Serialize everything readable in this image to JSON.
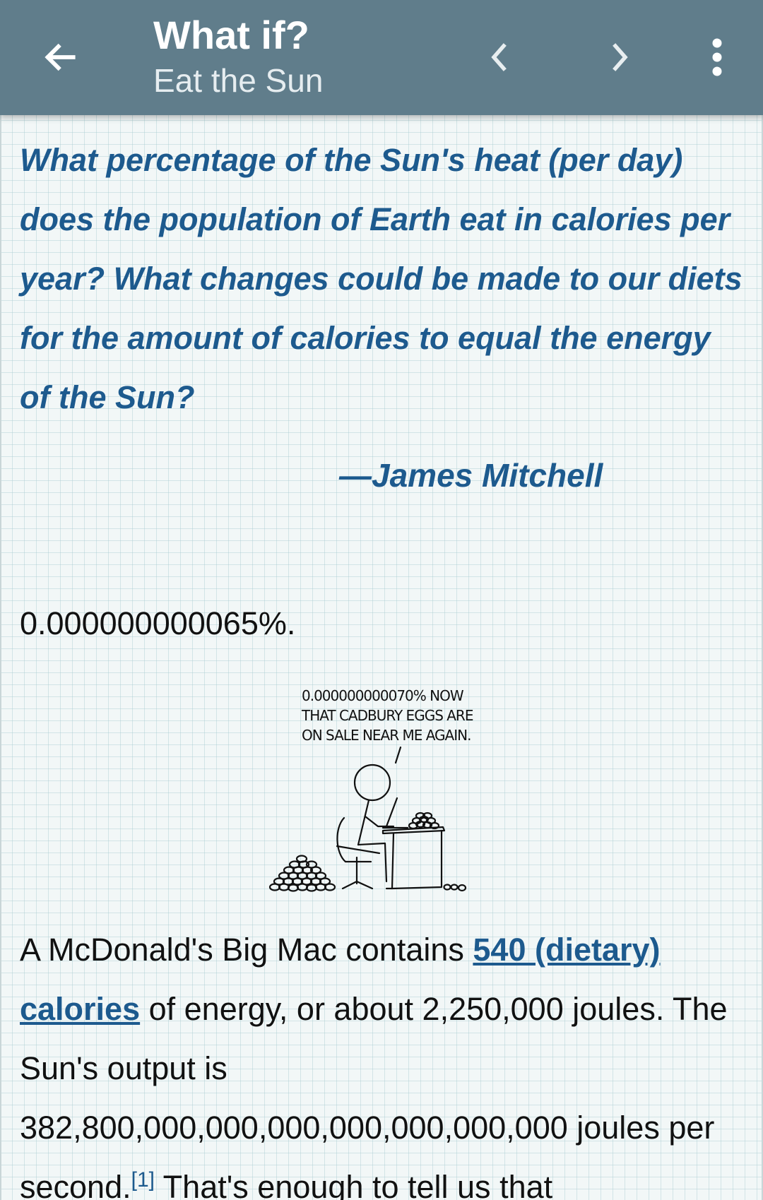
{
  "app_bar": {
    "title": "What if?",
    "subtitle": "Eat the Sun",
    "icons": [
      "arrow-left-icon",
      "chevron-left-icon",
      "chevron-right-icon",
      "more-vert-icon"
    ]
  },
  "article": {
    "question": "What percentage of the Sun's heat (per day) does the population of Earth eat in calories per year? What changes could be made to our diets for the amount of calories to equal the energy of the Sun?",
    "attribution": "—James Mitchell",
    "answer": "0.000000000065%.",
    "comic": {
      "caption_lines": [
        "0.000000000070% NOW",
        "THAT CADBURY EGGS ARE",
        "ON SALE NEAR ME AGAIN."
      ]
    },
    "paragraph": {
      "part1": "A McDonald's Big Mac contains ",
      "link": "540 (dietary) calories",
      "part2": " of energy, or about 2,250,000 joules. The Sun's output is 382,800,000,000,000,000,000,000,000 joules per second.",
      "footnote": "[1]",
      "part3": " That's enough to tell us that"
    }
  },
  "colors": {
    "app_bar": "#607d8b",
    "question_text": "#1d5a8e",
    "link": "#1d5a8e",
    "body_text": "#111111"
  }
}
